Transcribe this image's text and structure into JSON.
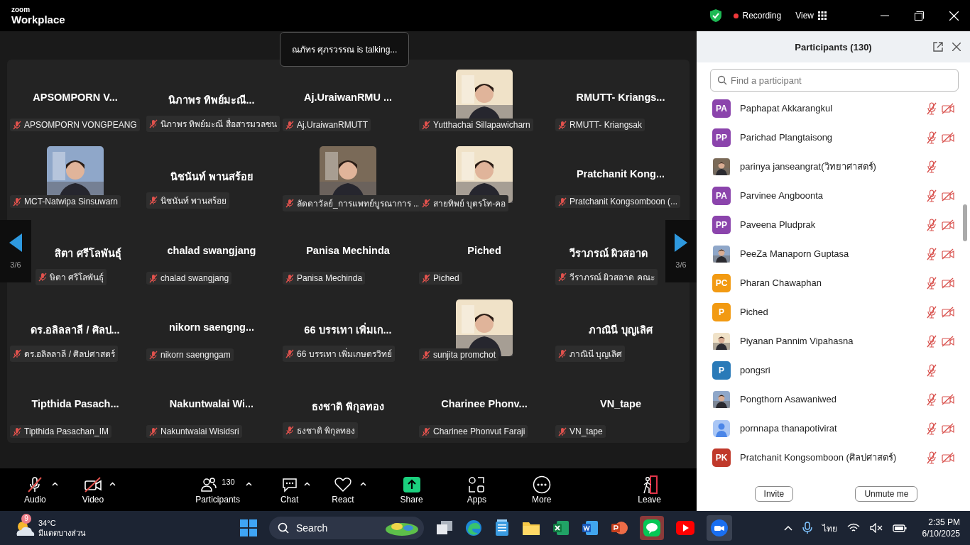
{
  "app": {
    "logo_top": "zoom",
    "logo_bottom": "Workplace",
    "recording": "Recording",
    "view": "View"
  },
  "toast": "ณภัทร ศุภรวรรณ is talking...",
  "pager": {
    "left": "3/6",
    "right": "3/6"
  },
  "tiles": [
    {
      "kind": "name",
      "title": "APSOMPORN  V...",
      "label": "APSOMPORN VONGPEANG"
    },
    {
      "kind": "name",
      "title": "นิภาพร ทิพย์มะณี...",
      "label": "นิภาพร ทิพย์มะณี สื่อสารมวลชน"
    },
    {
      "kind": "name",
      "title": "Aj.UraiwanRMU ...",
      "label": "Aj.UraiwanRMUTT"
    },
    {
      "kind": "picture",
      "label": "Yutthachai Sillapawicharn"
    },
    {
      "kind": "name",
      "title": "RMUTT-  Kriangs...",
      "label": "RMUTT- Kriangsak"
    },
    {
      "kind": "picture",
      "label": "MCT-Natwipa Sinsuwarn"
    },
    {
      "kind": "name",
      "title": "นิชนันท์ พานสร้อย",
      "label": "นิชนันท์ พานสร้อย"
    },
    {
      "kind": "picture",
      "label": "ลัดดาวัลย์_การแพทย์บูรณาการ ..."
    },
    {
      "kind": "picture",
      "label": "สายทิพย์ บุตรโท-คอ"
    },
    {
      "kind": "name",
      "title": "Pratchanit  Kong...",
      "label": "Pratchanit Kongsomboon (..."
    },
    {
      "kind": "name",
      "title": "สิตา  ศรีโลพันธุ์",
      "label": "ษิตา  ศรีโลพันธุ์"
    },
    {
      "kind": "name",
      "title": "chalad swangjang",
      "label": "chalad swangjang"
    },
    {
      "kind": "name",
      "title": "Panisa Mechinda",
      "label": "Panisa Mechinda"
    },
    {
      "kind": "name",
      "title": "Piched",
      "label": "Piched"
    },
    {
      "kind": "name",
      "title": "วีราภรณ์ ผิวสอาด",
      "label": "วีราภรณ์ ผิวสอาด คณะ"
    },
    {
      "kind": "name",
      "title": "ดร.อลิลลาลี / ศิลป...",
      "label": "ดร.อลิลลาลี / ศิลปศาสตร์"
    },
    {
      "kind": "name",
      "title": "nikorn  saengng...",
      "label": "nikorn saengngam"
    },
    {
      "kind": "name",
      "title": "66 บรรเทา เพิ่มเก...",
      "label": "66 บรรเทา เพิ่มเกษตรวิทย์"
    },
    {
      "kind": "picture",
      "label": "sunjita promchot"
    },
    {
      "kind": "name",
      "title": "ภาณินี บุญเลิศ",
      "label": "ภาณินี บุญเลิศ"
    },
    {
      "kind": "name",
      "title": "Tipthida  Pasach...",
      "label": "Tipthida Pasachan_IM"
    },
    {
      "kind": "name",
      "title": "Nakuntwalai  Wi...",
      "label": "Nakuntwalai Wisidsri"
    },
    {
      "kind": "name",
      "title": "ธงชาติ  พิกุลทอง",
      "label": "ธงชาติ  พิกุลทอง"
    },
    {
      "kind": "name",
      "title": "Charinee  Phonv...",
      "label": "Charinee Phonvut Faraji"
    },
    {
      "kind": "name",
      "title": "VN_tape",
      "label": "VN_tape"
    }
  ],
  "toolbar": [
    {
      "kind": "audio",
      "label": "Audio",
      "caret": true
    },
    {
      "kind": "video",
      "label": "Video",
      "caret": true
    },
    {
      "kind": "participants",
      "label": "Participants",
      "count": "130",
      "caret": true
    },
    {
      "kind": "chat",
      "label": "Chat",
      "caret": true
    },
    {
      "kind": "react",
      "label": "React",
      "caret": true
    },
    {
      "kind": "share",
      "label": "Share",
      "caret": false
    },
    {
      "kind": "apps",
      "label": "Apps",
      "caret": false
    },
    {
      "kind": "more",
      "label": "More",
      "caret": false
    },
    {
      "kind": "leave",
      "label": "Leave",
      "caret": false
    }
  ],
  "panel": {
    "title": "Participants (130)",
    "search": {
      "placeholder": "Find a participant"
    },
    "participants": [
      {
        "name": "Paphapat Akkarangkul",
        "kind": "initials",
        "initials": "PA",
        "color": "#8b44ac",
        "video_muted": true
      },
      {
        "name": "Parichad Plangtaisong",
        "kind": "initials",
        "initials": "PP",
        "color": "#8b44ac",
        "video_muted": true
      },
      {
        "name": "parinya janseangrat(วิทยาศาสตร์)",
        "kind": "picture",
        "video_muted": false
      },
      {
        "name": "Parvinee Angboonta",
        "kind": "initials",
        "initials": "PA",
        "color": "#8b44ac",
        "video_muted": true
      },
      {
        "name": "Paveena  Pludprak",
        "kind": "initials",
        "initials": "PP",
        "color": "#8b44ac",
        "video_muted": true
      },
      {
        "name": "PeeZa Manaporn Guptasa",
        "kind": "picture",
        "video_muted": true
      },
      {
        "name": "Pharan Chawaphan",
        "kind": "initials",
        "initials": "PC",
        "color": "#f29a12",
        "video_muted": true
      },
      {
        "name": "Piched",
        "kind": "initials",
        "initials": "P",
        "color": "#f29a12",
        "video_muted": true
      },
      {
        "name": "Piyanan Pannim Vipahasna",
        "kind": "picture",
        "video_muted": true
      },
      {
        "name": "pongsri",
        "kind": "initials",
        "initials": "P",
        "color": "#2a7ab8",
        "video_muted": false
      },
      {
        "name": "Pongthorn Asawaniwed",
        "kind": "picture",
        "video_muted": true
      },
      {
        "name": "pornnapa thanapotivirat",
        "kind": "silhouette",
        "video_muted": true
      },
      {
        "name": "Pratchanit Kongsomboon (ศิลปศาสตร์)",
        "kind": "initials",
        "initials": "PK",
        "color": "#c0392b",
        "video_muted": true
      }
    ],
    "buttons": [
      "Invite",
      "Unmute me"
    ]
  },
  "taskbar": {
    "badge": "9",
    "temperature": "34°C",
    "weather": "มีแดดบางส่วน",
    "search": "Search",
    "language": "ไทย",
    "time": "2:35 PM",
    "date": "6/10/2025"
  }
}
